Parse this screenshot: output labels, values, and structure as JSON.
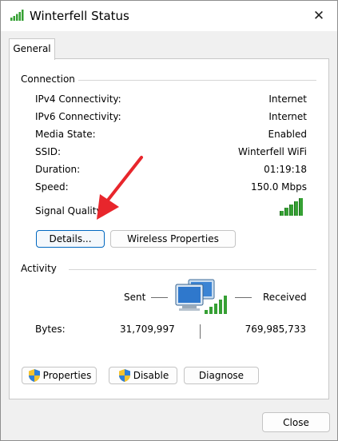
{
  "window": {
    "title": "Winterfell Status",
    "close_glyph": "✕"
  },
  "tabs": [
    {
      "label": "General"
    }
  ],
  "connection": {
    "heading": "Connection",
    "rows": [
      {
        "label": "IPv4 Connectivity:",
        "value": "Internet"
      },
      {
        "label": "IPv6 Connectivity:",
        "value": "Internet"
      },
      {
        "label": "Media State:",
        "value": "Enabled"
      },
      {
        "label": "SSID:",
        "value": "Winterfell WiFi"
      },
      {
        "label": "Duration:",
        "value": "01:19:18"
      },
      {
        "label": "Speed:",
        "value": "150.0 Mbps"
      }
    ],
    "signal_label": "Signal Quality",
    "signal_bars_lit": 5,
    "signal_bars_total": 5,
    "details_button": "Details...",
    "wireless_button": "Wireless Properties"
  },
  "activity": {
    "heading": "Activity",
    "sent_label": "Sent",
    "received_label": "Received",
    "bytes_label": "Bytes:",
    "bytes_sent": "31,709,997",
    "bytes_received": "769,985,733"
  },
  "buttons": {
    "properties": "Properties",
    "disable": "Disable",
    "diagnose": "Diagnose",
    "close": "Close"
  },
  "colors": {
    "signal_green": "#36a034",
    "focus_blue": "#0067c0",
    "annotation_red": "#e8262c"
  },
  "icons": {
    "title": "wifi-signal-icon",
    "network": "network-computers-icon",
    "shield": "uac-shield-icon"
  }
}
